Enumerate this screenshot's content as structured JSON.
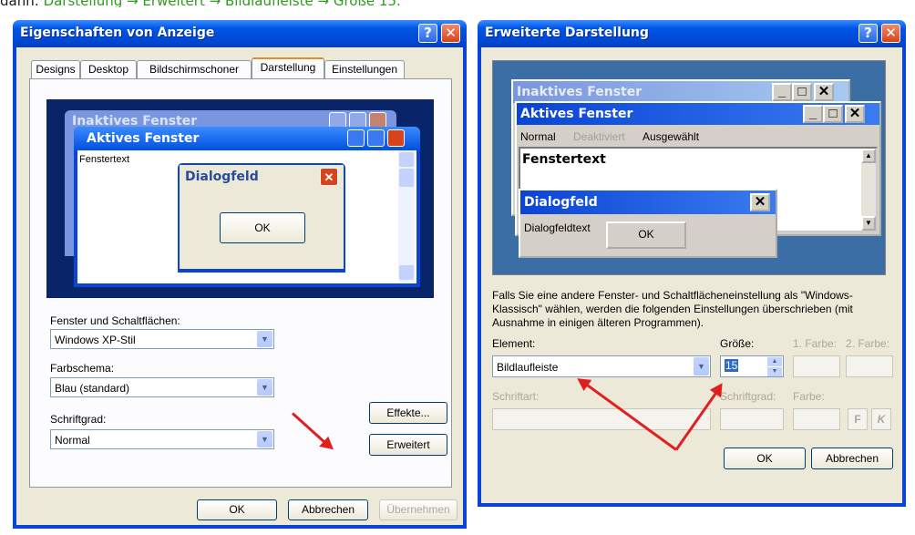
{
  "caption": {
    "prefix": "dann: ",
    "path": "Darstellung → Erweitert → Bildlaufleiste → Größe 15."
  },
  "left_window": {
    "title": "Eigenschaften von Anzeige",
    "help_glyph": "?",
    "close_glyph": "✕",
    "tabs": [
      "Designs",
      "Desktop",
      "Bildschirmschoner",
      "Darstellung",
      "Einstellungen"
    ],
    "active_tab": "Darstellung",
    "preview": {
      "inactive_title": "Inaktives Fenster",
      "active_title": "Aktives Fenster",
      "window_text": "Fenstertext",
      "dialog_title": "Dialogfeld",
      "dialog_ok": "OK"
    },
    "window_buttons_label": "Fenster und Schaltflächen:",
    "window_buttons_value": "Windows XP-Stil",
    "color_scheme_label": "Farbschema:",
    "color_scheme_value": "Blau (standard)",
    "font_size_label": "Schriftgrad:",
    "font_size_value": "Normal",
    "effects_button": "Effekte...",
    "advanced_button": "Erweitert",
    "ok": "OK",
    "cancel": "Abbrechen",
    "apply": "Übernehmen"
  },
  "right_window": {
    "title": "Erweiterte Darstellung",
    "help_glyph": "?",
    "close_glyph": "✕",
    "preview": {
      "inactive_title": "Inaktives Fenster",
      "active_title": "Aktives Fenster",
      "menu_normal": "Normal",
      "menu_disabled": "Deaktiviert",
      "menu_selected": "Ausgewählt",
      "window_text": "Fenstertext",
      "dialog_title": "Dialogfeld",
      "dialog_text": "Dialogfeldtext",
      "dialog_ok": "OK"
    },
    "info_text": "Falls Sie eine andere Fenster- und Schaltflächeneinstellung als \"Windows-Klassisch\" wählen, werden die folgenden Einstellungen überschrieben (mit Ausnahme in einigen älteren Programmen).",
    "element_label": "Element:",
    "element_value": "Bildlaufleiste",
    "size_label": "Größe:",
    "size_value": "15",
    "color1_label": "1. Farbe:",
    "color2_label": "2. Farbe:",
    "font_label": "Schriftart:",
    "font_size_label": "Schriftgrad:",
    "font_color_label": "Farbe:",
    "bold_label": "F",
    "italic_label": "K",
    "ok": "OK",
    "cancel": "Abbrechen"
  },
  "colors": {
    "xp_blue": "#0a44d6",
    "annotation_red": "#e02020",
    "caption_green": "#2f9a1e"
  }
}
